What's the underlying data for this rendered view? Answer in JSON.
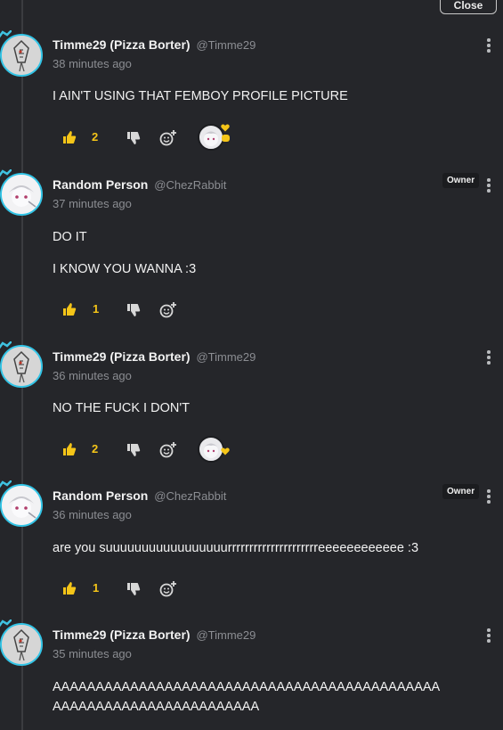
{
  "header": {
    "close_label": "Close"
  },
  "colors": {
    "accent": "#f5c518",
    "avatar_ring": "#32c4e6",
    "background": "#25262a"
  },
  "comments": [
    {
      "author": "Timme29 (Pizza Borter)",
      "handle": "@Timme29",
      "time": "38 minutes ago",
      "lines": [
        "I AIN'T USING THAT FEMBOY PROFILE PICTURE"
      ],
      "likes": "2",
      "avatar": "pizza-skeleton-avatar",
      "owner": false,
      "reaction_preview": "heart-and-comment"
    },
    {
      "author": "Random Person",
      "handle": "@ChezRabbit",
      "time": "37 minutes ago",
      "lines": [
        "DO IT",
        "I KNOW YOU WANNA :3"
      ],
      "likes": "1",
      "avatar": "anime-rabbit-avatar",
      "owner": true,
      "owner_label": "Owner"
    },
    {
      "author": "Timme29 (Pizza Borter)",
      "handle": "@Timme29",
      "time": "36 minutes ago",
      "lines": [
        "NO THE FUCK I DON'T"
      ],
      "likes": "2",
      "avatar": "pizza-skeleton-avatar",
      "owner": false,
      "reaction_preview": "heart"
    },
    {
      "author": "Random Person",
      "handle": "@ChezRabbit",
      "time": "36 minutes ago",
      "lines": [
        "are you suuuuuuuuuuuuuuuuurrrrrrrrrrrrrrrrrrrrreeeeeeeeeeee :3"
      ],
      "likes": "1",
      "avatar": "anime-rabbit-avatar",
      "owner": true,
      "owner_label": "Owner"
    },
    {
      "author": "Timme29 (Pizza Borter)",
      "handle": "@Timme29",
      "time": "35 minutes ago",
      "lines": [
        "AAAAAAAAAAAAAAAAAAAAAAAAAAAAAAAAAAAAAAAAAAAAA",
        "AAAAAAAAAAAAAAAAAAAAAAAA"
      ],
      "avatar": "pizza-skeleton-avatar",
      "owner": false
    }
  ]
}
